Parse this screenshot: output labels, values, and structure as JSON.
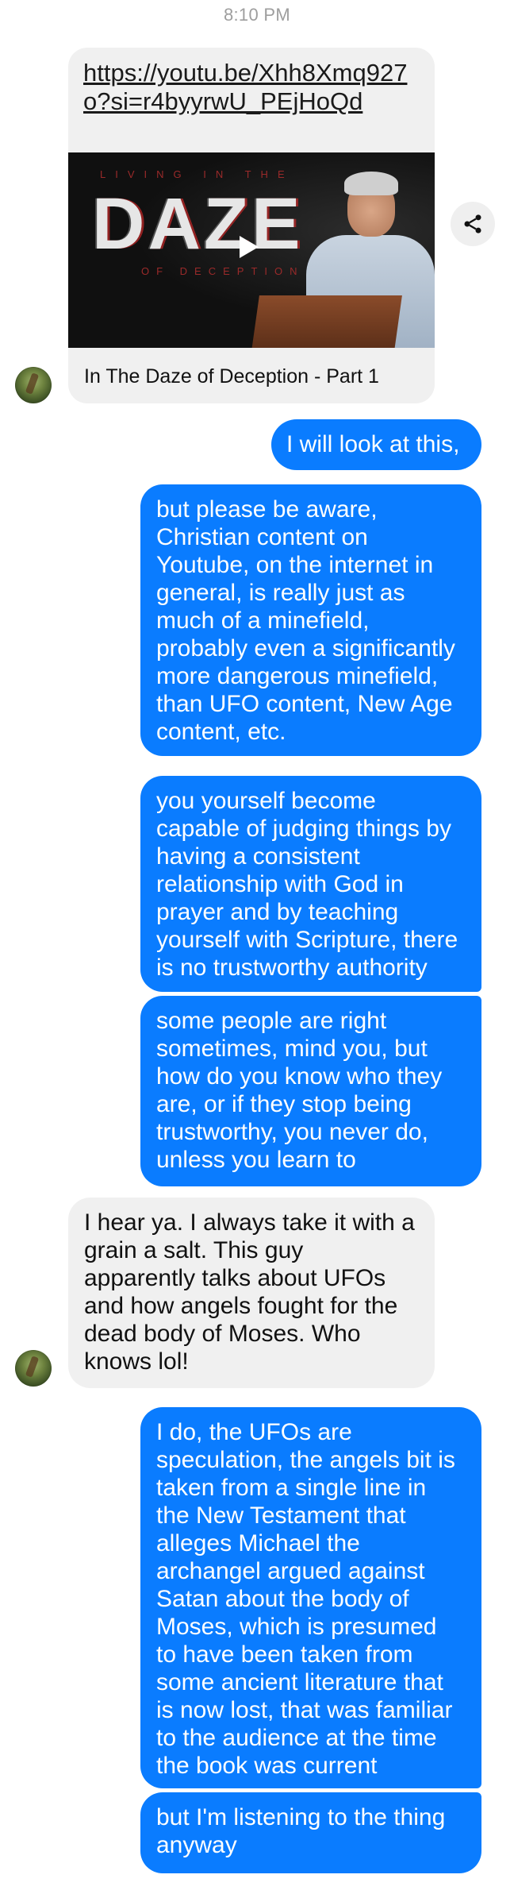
{
  "timestamp": "8:10 PM",
  "link_card": {
    "url": "https://youtu.be/Xhh8Xmq927o?si=r4byyrwU_PEjHoQd",
    "thumbnail": {
      "top_text": "LIVING IN THE",
      "title_text": "DAZE",
      "sub_text": "OF DECEPTION"
    },
    "title": "In The Daze of Deception - Part 1"
  },
  "icons": {
    "share": "share-icon",
    "play": "play-icon",
    "avatar": "contact-avatar"
  },
  "colors": {
    "outgoing": "#0a7cff",
    "incoming": "#f0f0f0"
  },
  "messages": [
    {
      "from": "me",
      "text": "I will look at this,"
    },
    {
      "from": "me",
      "text": "but please be aware,\nChristian content on\nYoutube, on the internet in\ngeneral, is really just as\nmuch of a minefield,\nprobably even a significantly\nmore dangerous minefield,\nthan UFO content, New Age\ncontent, etc."
    },
    {
      "from": "me",
      "text": "you yourself become\ncapable of judging things by\nhaving a consistent\nrelationship with God in\nprayer and by teaching\nyourself with Scripture, there\nis no trustworthy authority"
    },
    {
      "from": "me",
      "text": "some people are right\nsometimes, mind you, but\nhow do you know who they\nare, or if they stop being\ntrustworthy, you never do,\nunless you learn to"
    },
    {
      "from": "them",
      "text": "I hear ya. I always take it with a\ngrain a salt. This guy\napparently talks about UFOs\nand how angels fought for the\ndead body of Moses. Who\nknows lol!"
    },
    {
      "from": "me",
      "text": "I do, the UFOs are\nspeculation, the angels bit is\ntaken from a single line in\nthe New Testament that\nalleges Michael the\narchangel argued against\nSatan about the body of\nMoses, which is presumed\nto have been taken from\nsome ancient literature that\nis now lost, that was familiar\nto the audience at the time\nthe book was current"
    },
    {
      "from": "me",
      "text": "but I'm listening to the thing\nanyway"
    }
  ]
}
